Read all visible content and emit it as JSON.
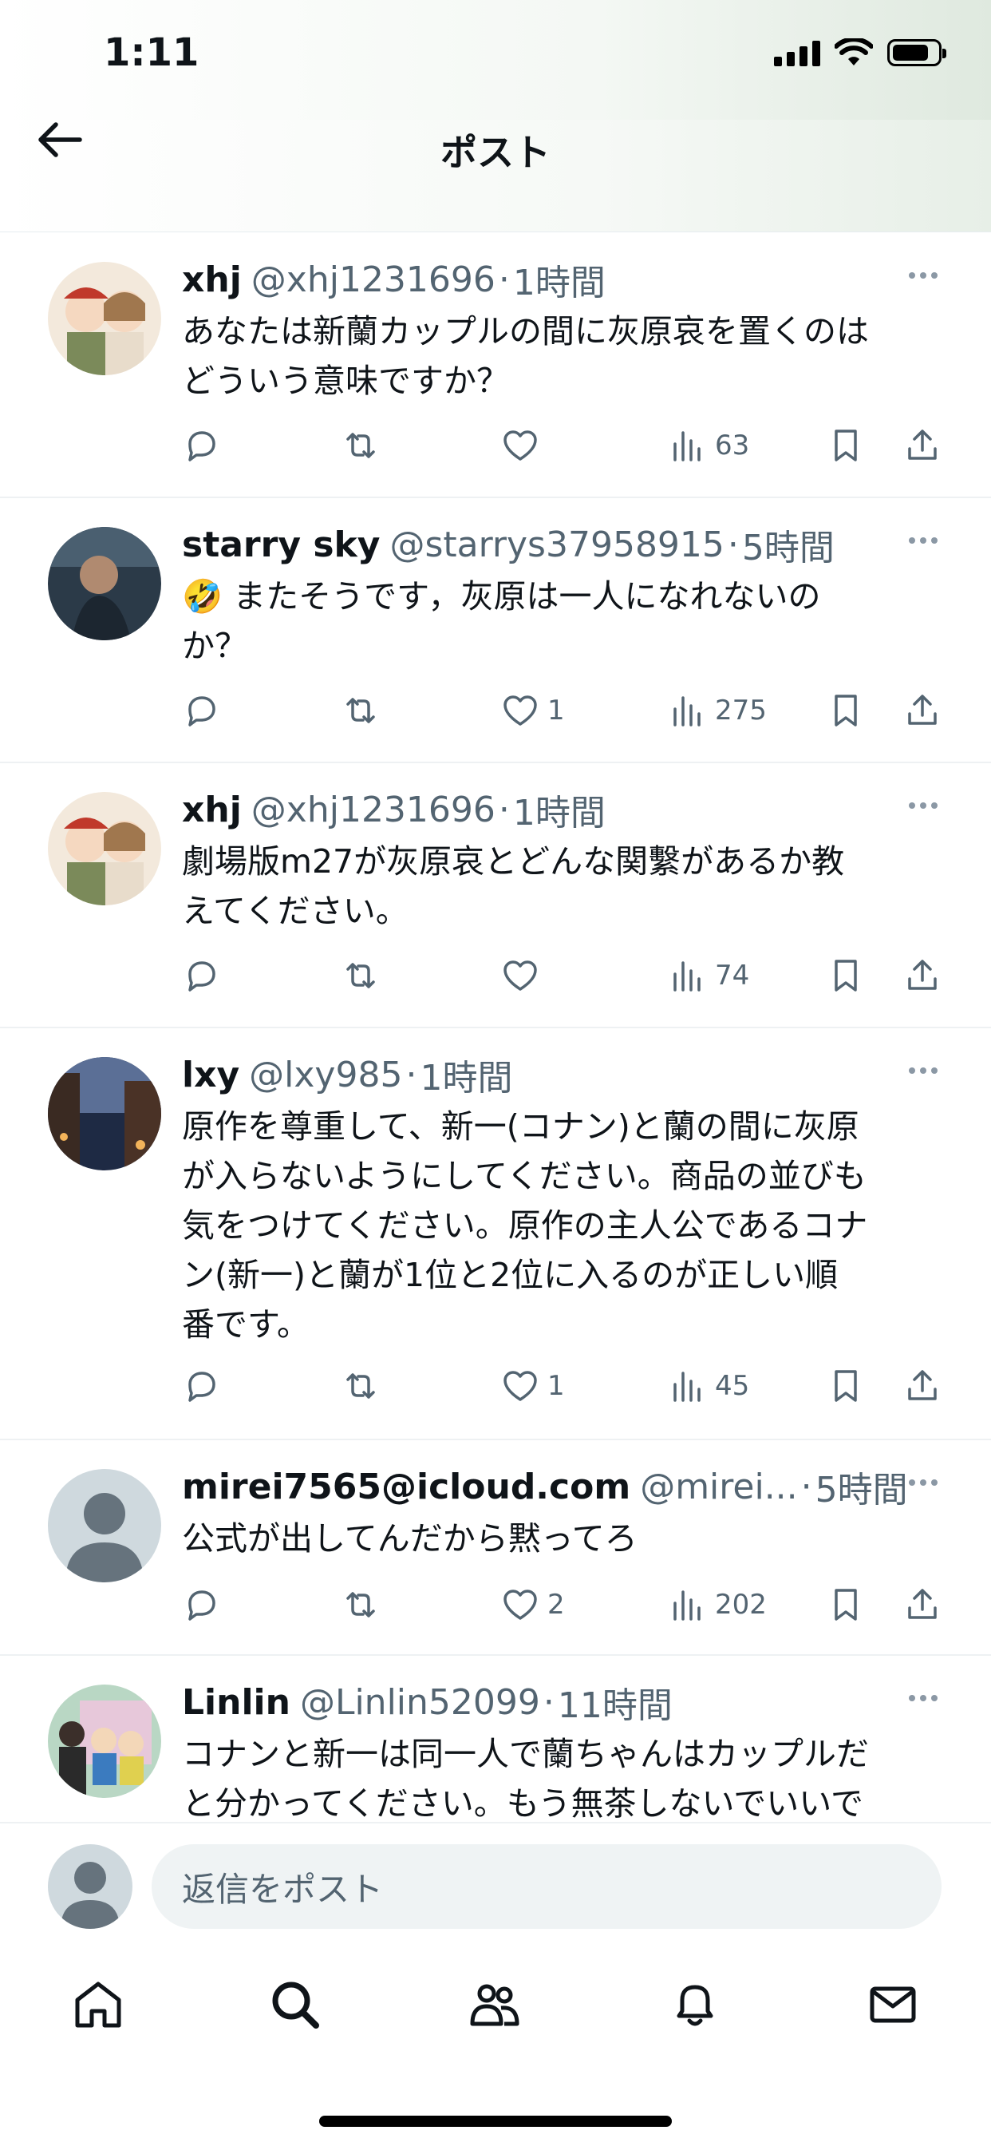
{
  "status_bar": {
    "time": "1:11"
  },
  "header": {
    "title": "ポスト"
  },
  "posts": [
    {
      "name": "xhj",
      "handle": "@xhj1231696",
      "separator": "·",
      "time": "1時間",
      "text": "あなたは新蘭カップルの間に灰原哀を置くのは\nどういう意味ですか？",
      "likes": "",
      "views": "63"
    },
    {
      "name": "starry sky",
      "handle": "@starrys37958915",
      "separator": "·",
      "time": "5時間",
      "text": "🤣 またそうです，灰原は一人になれないの\nか？",
      "likes": "1",
      "views": "275"
    },
    {
      "name": "xhj",
      "handle": "@xhj1231696",
      "separator": "·",
      "time": "1時間",
      "text": "劇場版m27が灰原哀とどんな関繫があるか教\nえてください。",
      "likes": "",
      "views": "74"
    },
    {
      "name": "lxy",
      "handle": "@lxy985",
      "separator": "·",
      "time": "1時間",
      "text": "原作を尊重して、新一(コナン)と蘭の間に灰原\nが入らないようにしてください。商品の並びも\n気をつけてください。原作の主人公であるコナ\nン(新一)と蘭が1位と2位に入るのが正しい順\n番です。",
      "likes": "1",
      "views": "45"
    },
    {
      "name": "mirei7565@icloud.com",
      "handle": "@mirei...",
      "separator": "·",
      "time": "5時間",
      "text": "公式が出してんだから黙ってろ",
      "likes": "2",
      "views": "202"
    },
    {
      "name": "Linlin",
      "handle": "@Linlin52099",
      "separator": "·",
      "time": "11時間",
      "text": "コナンと新一は同一人で蘭ちゃんはカップルだ\nと分かってください。もう無茶しないでいいで",
      "likes": "",
      "views": ""
    }
  ],
  "reply": {
    "placeholder": "返信をポスト"
  },
  "icons": {
    "back": "arrow-left-icon",
    "more": "more-horizontal-icon",
    "reply": "comment-icon",
    "repost": "repost-icon",
    "like": "heart-icon",
    "views": "analytics-icon",
    "bookmark": "bookmark-icon",
    "share": "share-icon",
    "tabs": [
      "home-icon",
      "search-icon",
      "communities-icon",
      "notifications-icon",
      "messages-icon"
    ]
  },
  "colors": {
    "text": "#0f1419",
    "secondary": "#536471",
    "divider": "#eef1f3",
    "input_bg": "#eff3f4"
  }
}
